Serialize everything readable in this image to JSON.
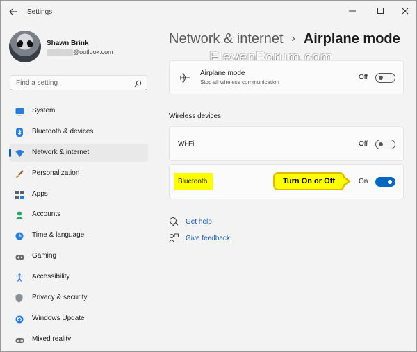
{
  "window": {
    "title": "Settings",
    "back_icon": "back-arrow-icon",
    "controls": {
      "minimize": "—",
      "maximize": "☐",
      "close": "✕"
    }
  },
  "user": {
    "name": "Shawn Brink",
    "email_domain": "@outlook.com"
  },
  "search": {
    "placeholder": "Find a setting"
  },
  "sidebar": {
    "items": [
      {
        "label": "System",
        "icon": "monitor-icon",
        "color": "#2b7bd9"
      },
      {
        "label": "Bluetooth & devices",
        "icon": "bluetooth-icon",
        "color": "#2b7bd9"
      },
      {
        "label": "Network & internet",
        "icon": "wifi-icon",
        "color": "#2b7bd9",
        "selected": true
      },
      {
        "label": "Personalization",
        "icon": "brush-icon",
        "color": "#d9822b"
      },
      {
        "label": "Apps",
        "icon": "apps-icon",
        "color": "#5a6470"
      },
      {
        "label": "Accounts",
        "icon": "person-icon",
        "color": "#2ea36b"
      },
      {
        "label": "Time & language",
        "icon": "globe-clock-icon",
        "color": "#2b7bd9"
      },
      {
        "label": "Gaming",
        "icon": "gamepad-icon",
        "color": "#6b6b6b"
      },
      {
        "label": "Accessibility",
        "icon": "accessibility-icon",
        "color": "#2b7bd9"
      },
      {
        "label": "Privacy & security",
        "icon": "shield-icon",
        "color": "#6b6b6b"
      },
      {
        "label": "Windows Update",
        "icon": "update-icon",
        "color": "#2b7bd9"
      },
      {
        "label": "Mixed reality",
        "icon": "headset-icon",
        "color": "#6b6b6b"
      }
    ]
  },
  "breadcrumb": {
    "parent": "Network & internet",
    "separator": "›",
    "current": "Airplane mode"
  },
  "watermark": "ElevenForum.com",
  "airplane": {
    "title": "Airplane mode",
    "subtitle": "Stop all wireless communication",
    "state": "Off",
    "icon": "airplane-icon"
  },
  "wireless": {
    "section_title": "Wireless devices",
    "wifi": {
      "label": "Wi-Fi",
      "state": "Off"
    },
    "bluetooth": {
      "label": "Bluetooth",
      "state": "On"
    }
  },
  "callout": {
    "text": "Turn On or Off"
  },
  "help": {
    "get_help": "Get help",
    "give_feedback": "Give feedback"
  },
  "colors": {
    "accent": "#0067c0",
    "highlight": "#ffff00",
    "link": "#1a5aa8"
  }
}
